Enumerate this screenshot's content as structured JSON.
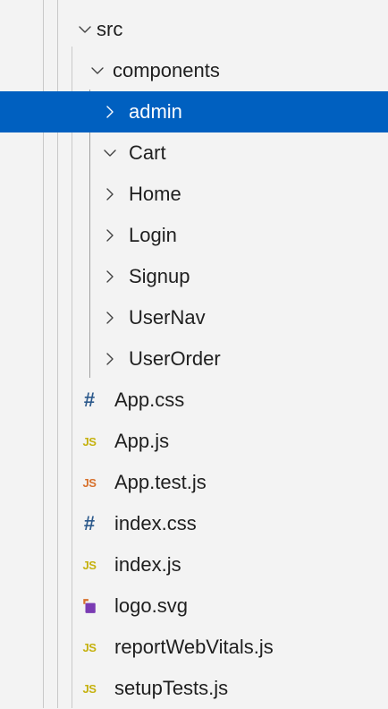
{
  "explorer": {
    "items": [
      {
        "id": "src",
        "label": "src",
        "kind": "folder",
        "expanded": true,
        "depth": 0
      },
      {
        "id": "components",
        "label": "components",
        "kind": "folder",
        "expanded": true,
        "depth": 1
      },
      {
        "id": "admin",
        "label": "admin",
        "kind": "folder",
        "expanded": false,
        "depth": 2,
        "selected": true
      },
      {
        "id": "cart",
        "label": "Cart",
        "kind": "folder",
        "expanded": true,
        "depth": 2
      },
      {
        "id": "home",
        "label": "Home",
        "kind": "folder",
        "expanded": false,
        "depth": 2
      },
      {
        "id": "login",
        "label": "Login",
        "kind": "folder",
        "expanded": false,
        "depth": 2
      },
      {
        "id": "signup",
        "label": "Signup",
        "kind": "folder",
        "expanded": false,
        "depth": 2
      },
      {
        "id": "usernav",
        "label": "UserNav",
        "kind": "folder",
        "expanded": false,
        "depth": 2
      },
      {
        "id": "userorder",
        "label": "UserOrder",
        "kind": "folder",
        "expanded": false,
        "depth": 2
      },
      {
        "id": "app-css",
        "label": "App.css",
        "kind": "css",
        "icon_text": "#",
        "depth": 1
      },
      {
        "id": "app-js",
        "label": "App.js",
        "kind": "js",
        "icon_text": "JS",
        "depth": 1
      },
      {
        "id": "app-test-js",
        "label": "App.test.js",
        "kind": "js-test",
        "icon_text": "JS",
        "depth": 1
      },
      {
        "id": "index-css",
        "label": "index.css",
        "kind": "css",
        "icon_text": "#",
        "depth": 1
      },
      {
        "id": "index-js",
        "label": "index.js",
        "kind": "js",
        "icon_text": "JS",
        "depth": 1
      },
      {
        "id": "logo-svg",
        "label": "logo.svg",
        "kind": "svg",
        "depth": 1
      },
      {
        "id": "report-web-vitals",
        "label": "reportWebVitals.js",
        "kind": "js",
        "icon_text": "JS",
        "depth": 1
      },
      {
        "id": "setup-tests",
        "label": "setupTests.js",
        "kind": "js",
        "icon_text": "JS",
        "depth": 1
      }
    ]
  },
  "colors": {
    "background": "#f3f3f3",
    "selection": "#0060c0",
    "js_icon": "#c5b10e",
    "js_test_icon": "#d7702b",
    "css_icon": "#2d5a8c",
    "svg_icon_primary": "#7a3bb3",
    "svg_icon_accent": "#d7702b"
  }
}
